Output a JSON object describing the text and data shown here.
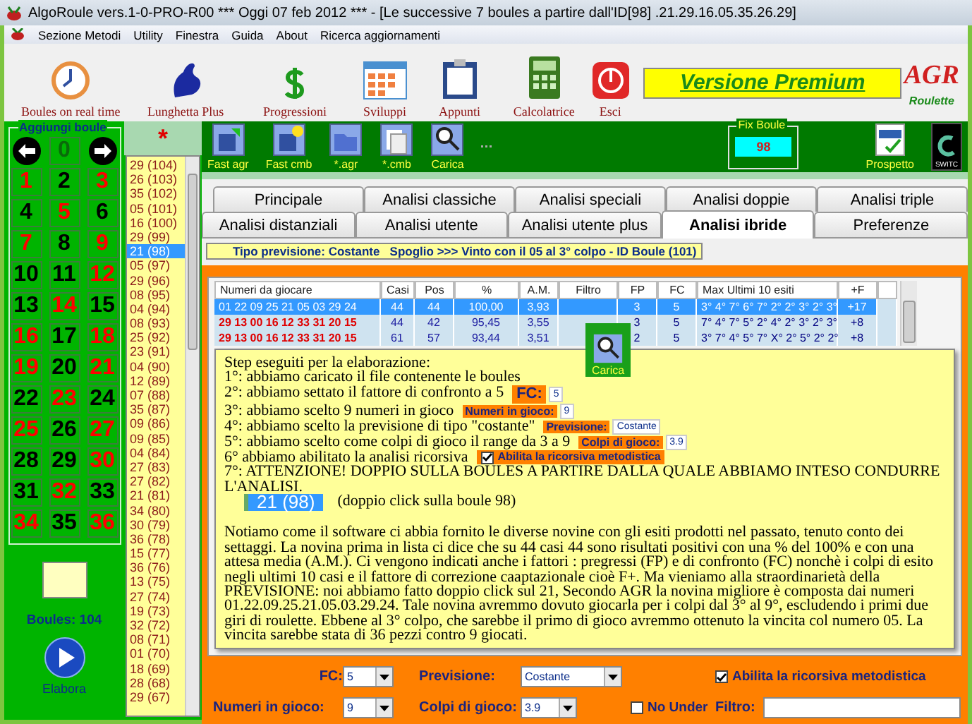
{
  "window": {
    "title": "AlgoRoule vers.1-0-PRO-R00  ***  Oggi 07 feb 2012  ***   - [Le successive 7 boules a partire dall'ID[98] .21.29.16.05.35.26.29]"
  },
  "menu": [
    "Sezione Metodi",
    "Utility",
    "Finestra",
    "Guida",
    "About",
    "Ricerca aggiornamenti"
  ],
  "toolbar": [
    {
      "kind": "clock",
      "label": "Boules on real time"
    },
    {
      "kind": "lottery",
      "label": "Lunghetta Plus"
    },
    {
      "kind": "dollar",
      "label": "Progressioni"
    },
    {
      "kind": "calendar",
      "label": "Sviluppi"
    },
    {
      "kind": "clipboard",
      "label": "Appunti"
    },
    {
      "kind": "calculator",
      "label": "Calcolatrice"
    },
    {
      "kind": "exit",
      "label": "Esci"
    }
  ],
  "premium_banner": "Versione Premium",
  "logo": {
    "letters": "AGR",
    "caption": "Roulette"
  },
  "boule_panel": {
    "title": "Aggiungi boule",
    "zero": "0",
    "numbers": [
      {
        "label": "1",
        "color": "#ff0000"
      },
      {
        "label": "2",
        "color": "#000000"
      },
      {
        "label": "3",
        "color": "#ff0000"
      },
      {
        "label": "4",
        "color": "#000000"
      },
      {
        "label": "5",
        "color": "#ff0000"
      },
      {
        "label": "6",
        "color": "#000000"
      },
      {
        "label": "7",
        "color": "#ff0000"
      },
      {
        "label": "8",
        "color": "#000000"
      },
      {
        "label": "9",
        "color": "#ff0000"
      },
      {
        "label": "10",
        "color": "#000000"
      },
      {
        "label": "11",
        "color": "#000000"
      },
      {
        "label": "12",
        "color": "#ff0000"
      },
      {
        "label": "13",
        "color": "#000000"
      },
      {
        "label": "14",
        "color": "#ff0000"
      },
      {
        "label": "15",
        "color": "#000000"
      },
      {
        "label": "16",
        "color": "#ff0000"
      },
      {
        "label": "17",
        "color": "#000000"
      },
      {
        "label": "18",
        "color": "#ff0000"
      },
      {
        "label": "19",
        "color": "#ff0000"
      },
      {
        "label": "20",
        "color": "#000000"
      },
      {
        "label": "21",
        "color": "#ff0000"
      },
      {
        "label": "22",
        "color": "#000000"
      },
      {
        "label": "23",
        "color": "#ff0000"
      },
      {
        "label": "24",
        "color": "#000000"
      },
      {
        "label": "25",
        "color": "#ff0000"
      },
      {
        "label": "26",
        "color": "#000000"
      },
      {
        "label": "27",
        "color": "#ff0000"
      },
      {
        "label": "28",
        "color": "#000000"
      },
      {
        "label": "29",
        "color": "#000000"
      },
      {
        "label": "30",
        "color": "#ff0000"
      },
      {
        "label": "31",
        "color": "#000000"
      },
      {
        "label": "32",
        "color": "#ff0000"
      },
      {
        "label": "33",
        "color": "#000000"
      },
      {
        "label": "34",
        "color": "#ff0000"
      },
      {
        "label": "35",
        "color": "#000000"
      },
      {
        "label": "36",
        "color": "#ff0000"
      }
    ],
    "count": "Boules: 104",
    "run_button": "Elabora"
  },
  "history": {
    "header": "*",
    "items": [
      {
        "label": "29 (104)",
        "selected": false
      },
      {
        "label": "26 (103)",
        "selected": false
      },
      {
        "label": "35 (102)",
        "selected": false
      },
      {
        "label": "05 (101)",
        "selected": false
      },
      {
        "label": "16 (100)",
        "selected": false
      },
      {
        "label": "29 (99)",
        "selected": false
      },
      {
        "label": "21 (98)",
        "selected": true
      },
      {
        "label": "05 (97)",
        "selected": false
      },
      {
        "label": "29 (96)",
        "selected": false
      },
      {
        "label": "08 (95)",
        "selected": false
      },
      {
        "label": "04 (94)",
        "selected": false
      },
      {
        "label": "08 (93)",
        "selected": false
      },
      {
        "label": "25 (92)",
        "selected": false
      },
      {
        "label": "23 (91)",
        "selected": false
      },
      {
        "label": "04 (90)",
        "selected": false
      },
      {
        "label": "12 (89)",
        "selected": false
      },
      {
        "label": "07 (88)",
        "selected": false
      },
      {
        "label": "35 (87)",
        "selected": false
      },
      {
        "label": "09 (86)",
        "selected": false
      },
      {
        "label": "09 (85)",
        "selected": false
      },
      {
        "label": "04 (84)",
        "selected": false
      },
      {
        "label": "27 (83)",
        "selected": false
      },
      {
        "label": "27 (82)",
        "selected": false
      },
      {
        "label": "21 (81)",
        "selected": false
      },
      {
        "label": "34 (80)",
        "selected": false
      },
      {
        "label": "30 (79)",
        "selected": false
      },
      {
        "label": "36 (78)",
        "selected": false
      },
      {
        "label": "15 (77)",
        "selected": false
      },
      {
        "label": "36 (76)",
        "selected": false
      },
      {
        "label": "13 (75)",
        "selected": false
      },
      {
        "label": "27 (74)",
        "selected": false
      },
      {
        "label": "19 (73)",
        "selected": false
      },
      {
        "label": "32 (72)",
        "selected": false
      },
      {
        "label": "08 (71)",
        "selected": false
      },
      {
        "label": "01 (70)",
        "selected": false
      },
      {
        "label": "18 (69)",
        "selected": false
      },
      {
        "label": "28 (68)",
        "selected": false
      },
      {
        "label": "29 (67)",
        "selected": false
      }
    ]
  },
  "file_toolbar": [
    {
      "kind": "save-arrow",
      "label": "Fast agr"
    },
    {
      "kind": "save-star",
      "label": "Fast cmb"
    },
    {
      "kind": "folder",
      "label": "*.agr"
    },
    {
      "kind": "pages",
      "label": "*.cmb"
    },
    {
      "kind": "load",
      "label": "Carica"
    }
  ],
  "fix_boule": {
    "label": "Fix Boule",
    "value": "98"
  },
  "report_button": {
    "label": "Prospetto"
  },
  "switch_button": {
    "label": "SWITC"
  },
  "tabs_row_1": [
    {
      "label": "Principale",
      "selected": false
    },
    {
      "label": "Analisi classiche",
      "selected": false
    },
    {
      "label": "Analisi speciali",
      "selected": false
    },
    {
      "label": "Analisi doppie",
      "selected": false
    },
    {
      "label": "Analisi triple",
      "selected": false
    }
  ],
  "tabs_row_2": [
    {
      "label": "Analisi distanziali",
      "selected": false
    },
    {
      "label": "Analisi utente",
      "selected": false
    },
    {
      "label": "Analisi utente plus",
      "selected": false
    },
    {
      "label": "Analisi ibride",
      "selected": true
    },
    {
      "label": "Preferenze",
      "selected": false
    }
  ],
  "status_banner": "Tipo previsione: Costante   Spoglio >>> Vinto con il 05 al 3° colpo - ID Boule (101)",
  "table": {
    "columns": [
      "Numeri da giocare",
      "Casi",
      "Pos",
      "%",
      "A.M.",
      "Filtro",
      "FP",
      "FC",
      "Max Ultimi 10 esiti",
      "+F"
    ],
    "rows": [
      {
        "selected": true,
        "highlight": false,
        "cells": [
          "01 22 09 25 21 05 03 29 24",
          "44",
          "44",
          "100,00",
          "3,93",
          "",
          "3",
          "5",
          "3° 4° 7° 6° 7° 2° 2° 3° 2° 3°",
          "+17"
        ]
      },
      {
        "selected": false,
        "highlight": true,
        "cells": [
          "29 13 00 16 12 33 31 20 15",
          "44",
          "42",
          "95,45",
          "3,55",
          "",
          "3",
          "5",
          "7° 4° 7° 5° 2° 4° 2° 3° 2° 3°",
          "+8"
        ]
      },
      {
        "selected": false,
        "highlight": true,
        "cells": [
          "29 13 00 16 12 33 31 20 15",
          "61",
          "57",
          "93,44",
          "3,51",
          "",
          "2",
          "5",
          "3° 7° 4° 5° 7° X° 2° 5° 2° 2°",
          "+8"
        ]
      }
    ]
  },
  "floating_button": {
    "label": "Carica"
  },
  "note": {
    "title": "Step eseguiti per la elaborazione:",
    "steps": [
      {
        "text": "1°: abbiamo caricato il file contenente le boules"
      },
      {
        "text": "2°: abbiamo settato il fattore di confronto a 5",
        "widget": {
          "kind": "big_field",
          "label": "FC:",
          "value": "5"
        }
      },
      {
        "text": "3°: abbiamo scelto 9 numeri in gioco",
        "widget": {
          "kind": "field",
          "label": "Numeri in gioco:",
          "value": "9"
        }
      },
      {
        "text": "4°: abbiamo scelto la previsione di tipo \"costante\"",
        "widget": {
          "kind": "field",
          "label": "Previsione:",
          "value": "Costante"
        }
      },
      {
        "text": "5°: abbiamo scelto come colpi di gioco il range da 3 a 9",
        "widget": {
          "kind": "field",
          "label": "Colpi di gioco:",
          "value": "3.9"
        }
      },
      {
        "text": "6° abbiamo abilitato la analisi ricorsiva",
        "widget": {
          "kind": "checkbox",
          "label": "Abilita la ricorsiva metodistica",
          "checked": true
        }
      },
      {
        "text": "7°: ATTENZIONE!  DOPPIO SULLA BOULES A PARTIRE DALLA QUALE ABBIAMO INTESO CONDURRE L'ANALISI.",
        "widget": {
          "kind": "list_item",
          "value": "21 (98)"
        },
        "suffix": "(doppio click sulla boule 98)"
      }
    ],
    "paragraph": "Notiamo come il software ci abbia fornito le diverse novine con gli esiti prodotti nel passato, tenuto conto dei settaggi. La novina prima in lista ci dice che su 44 casi  44 sono risultati positivi con una % del 100% e con una attesa media (A.M.). Ci vengono indicati anche i fattori : pregressi (FP) e di confronto (FC) nonchè i colpi di esito negli ultimi 10 casi e il fattore di correzione caaptazionale cioè F+. Ma vieniamo alla straordinarietà della PREVISIONE: noi abbiamo fatto doppio click sul 21, Secondo AGR la novina migliore è composta dai numeri 01.22.09.25.21.05.03.29.24. Tale novina avremmo dovuto giocarla per i colpi dal 3° al 9°, escludendo i primi due giri di roulette. Ebbene al 3° colpo, che sarebbe il primo di gioco avremmo ottenuto la vincita col numero 05. La vincita sarebbe stata di 36 pezzi contro 9 giocati."
  },
  "controls": {
    "fc": {
      "label": "FC:",
      "value": "5"
    },
    "numeri": {
      "label": "Numeri in gioco:",
      "value": "9"
    },
    "previsione": {
      "label": "Previsione:",
      "value": "Costante"
    },
    "colpi": {
      "label": "Colpi di gioco:",
      "value": "3.9"
    },
    "no_under": {
      "label": "No Under",
      "checked": false
    },
    "ricorsiva": {
      "label": "Abilita la ricorsiva metodistica",
      "checked": true
    },
    "filtro": {
      "label": "Filtro:"
    }
  }
}
